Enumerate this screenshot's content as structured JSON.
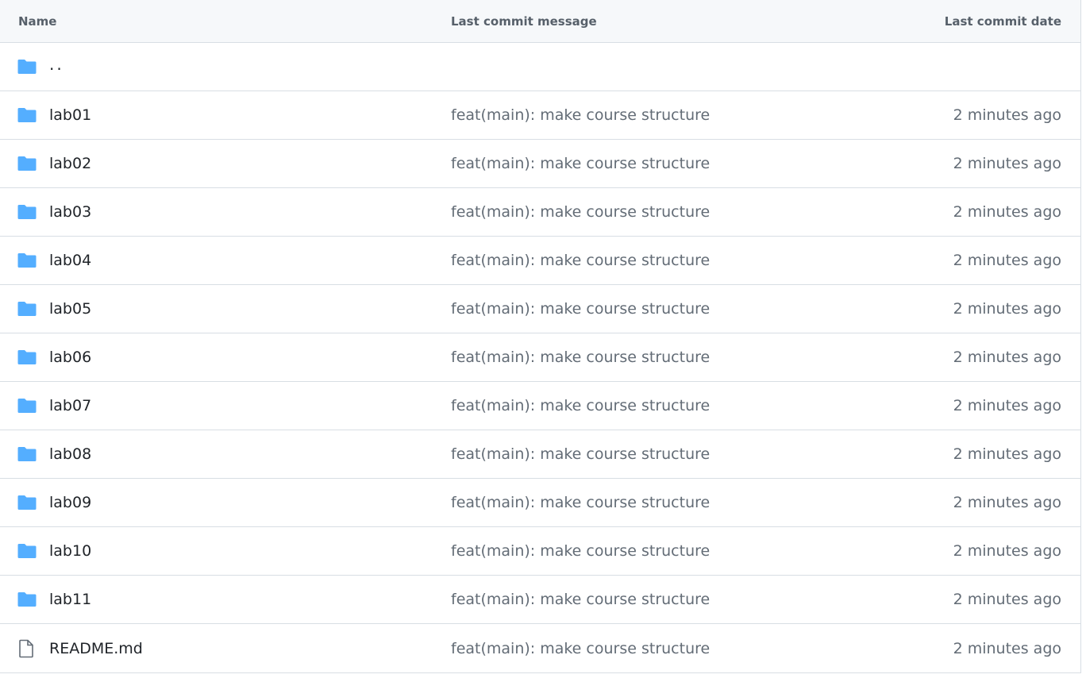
{
  "header": {
    "name": "Name",
    "message": "Last commit message",
    "date": "Last commit date"
  },
  "parent_link": "..",
  "rows": [
    {
      "type": "folder",
      "name": "lab01",
      "message": "feat(main): make course structure",
      "date": "2 minutes ago"
    },
    {
      "type": "folder",
      "name": "lab02",
      "message": "feat(main): make course structure",
      "date": "2 minutes ago"
    },
    {
      "type": "folder",
      "name": "lab03",
      "message": "feat(main): make course structure",
      "date": "2 minutes ago"
    },
    {
      "type": "folder",
      "name": "lab04",
      "message": "feat(main): make course structure",
      "date": "2 minutes ago"
    },
    {
      "type": "folder",
      "name": "lab05",
      "message": "feat(main): make course structure",
      "date": "2 minutes ago"
    },
    {
      "type": "folder",
      "name": "lab06",
      "message": "feat(main): make course structure",
      "date": "2 minutes ago"
    },
    {
      "type": "folder",
      "name": "lab07",
      "message": "feat(main): make course structure",
      "date": "2 minutes ago"
    },
    {
      "type": "folder",
      "name": "lab08",
      "message": "feat(main): make course structure",
      "date": "2 minutes ago"
    },
    {
      "type": "folder",
      "name": "lab09",
      "message": "feat(main): make course structure",
      "date": "2 minutes ago"
    },
    {
      "type": "folder",
      "name": "lab10",
      "message": "feat(main): make course structure",
      "date": "2 minutes ago"
    },
    {
      "type": "folder",
      "name": "lab11",
      "message": "feat(main): make course structure",
      "date": "2 minutes ago"
    },
    {
      "type": "file",
      "name": "README.md",
      "message": "feat(main): make course structure",
      "date": "2 minutes ago"
    }
  ],
  "colors": {
    "folder_icon": "#54aeff",
    "file_icon": "#636c76",
    "header_bg": "#f6f8fa",
    "border": "#d8dee4"
  },
  "icons": {
    "folder": "folder-icon",
    "file": "file-icon"
  }
}
